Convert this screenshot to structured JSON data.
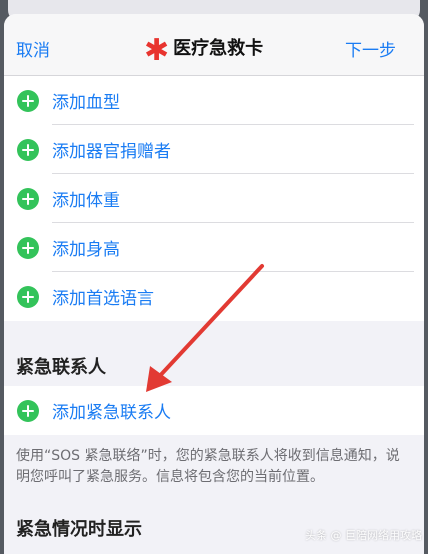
{
  "nav": {
    "cancel": "取消",
    "title": "医疗急救卡",
    "next": "下一步"
  },
  "list_items": [
    {
      "label": "添加血型"
    },
    {
      "label": "添加器官捐赠者"
    },
    {
      "label": "添加体重"
    },
    {
      "label": "添加身高"
    },
    {
      "label": "添加首选语言"
    }
  ],
  "emergency_section": {
    "header": "紧急联系人",
    "add_contact": "添加紧急联系人",
    "footnote": "使用“SOS 紧急联络”时，您的紧急联系人将收到信息通知，说明您呼叫了紧急服务。信息将包含您的当前位置。"
  },
  "lock_section": {
    "header": "紧急情况时显示"
  },
  "watermark": "头条 @ 巨陪网络用攻略",
  "colors": {
    "accent": "#1a7cf3",
    "plus_green": "#33c35a",
    "asterisk_red": "#e8342f",
    "annotation_arrow": "#e23a33"
  }
}
